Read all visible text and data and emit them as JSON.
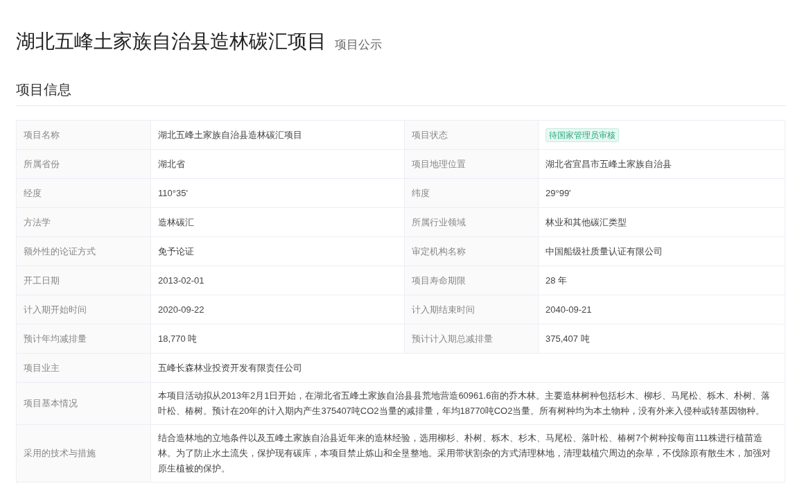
{
  "page": {
    "title": "湖北五峰土家族自治县造林碳汇项目",
    "subtitle": "项目公示"
  },
  "section": {
    "title": "项目信息"
  },
  "rows": [
    {
      "fields": [
        {
          "label": "项目名称",
          "value": "湖北五峰土家族自治县造林碳汇项目",
          "kind": "text"
        },
        {
          "label": "项目状态",
          "value": "待国家管理员审核",
          "kind": "tag"
        }
      ]
    },
    {
      "fields": [
        {
          "label": "所属省份",
          "value": "湖北省",
          "kind": "text"
        },
        {
          "label": "项目地理位置",
          "value": "湖北省宜昌市五峰土家族自治县",
          "kind": "text"
        }
      ]
    },
    {
      "fields": [
        {
          "label": "经度",
          "value": "110°35'",
          "kind": "text"
        },
        {
          "label": "纬度",
          "value": "29°99'",
          "kind": "text"
        }
      ]
    },
    {
      "fields": [
        {
          "label": "方法学",
          "value": "造林碳汇",
          "kind": "text"
        },
        {
          "label": "所属行业领域",
          "value": "林业和其他碳汇类型",
          "kind": "text"
        }
      ]
    },
    {
      "fields": [
        {
          "label": "额外性的论证方式",
          "value": "免予论证",
          "kind": "text"
        },
        {
          "label": "审定机构名称",
          "value": "中国船级社质量认证有限公司",
          "kind": "text"
        }
      ]
    },
    {
      "fields": [
        {
          "label": "开工日期",
          "value": "2013-02-01",
          "kind": "text"
        },
        {
          "label": "项目寿命期限",
          "value": "28 年",
          "kind": "text"
        }
      ]
    },
    {
      "fields": [
        {
          "label": "计入期开始时间",
          "value": "2020-09-22",
          "kind": "text"
        },
        {
          "label": "计入期结束时间",
          "value": "2040-09-21",
          "kind": "text"
        }
      ]
    },
    {
      "fields": [
        {
          "label": "预计年均减排量",
          "value": "18,770 吨",
          "kind": "text"
        },
        {
          "label": "预计计入期总减排量",
          "value": "375,407 吨",
          "kind": "text"
        }
      ]
    },
    {
      "fields": [
        {
          "label": "项目业主",
          "value": "五峰长森林业投资开发有限责任公司",
          "kind": "text"
        }
      ]
    },
    {
      "fields": [
        {
          "label": "项目基本情况",
          "value": "本项目活动拟从2013年2月1日开始，在湖北省五峰土家族自治县县荒地营造60961.6亩的乔木林。主要造林树种包括杉木、柳杉、马尾松、栎木、朴树、落叶松、椿树。预计在20年的计入期内产生375407吨CO2当量的减排量，年均18770吨CO2当量。所有树种均为本土物种，没有外来入侵种或转基因物种。",
          "kind": "text"
        }
      ]
    },
    {
      "fields": [
        {
          "label": "采用的技术与措施",
          "value": "结合造林地的立地条件以及五峰土家族自治县近年来的造林经验，选用柳杉、朴树、栎木、杉木、马尾松、落叶松、椿树7个树种按每亩111株进行植苗造林。为了防止水土流失，保护现有碳库，本项目禁止炼山和全垦整地。采用带状割杂的方式清理林地，清理栽植穴周边的杂草，不伐除原有散生木，加强对原生植被的保护。",
          "kind": "text"
        }
      ]
    }
  ]
}
